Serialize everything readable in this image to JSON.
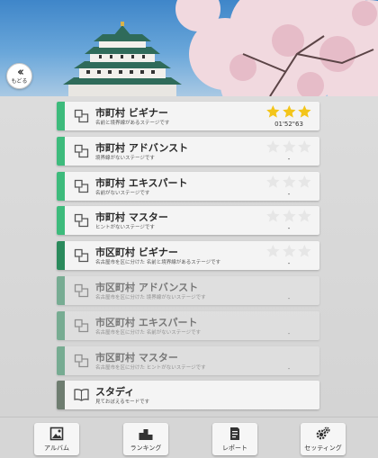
{
  "header": {
    "back_label": "もどる"
  },
  "stages": [
    {
      "title": "市町村 ビギナー",
      "subtitle": "名前と境界線があるステージです",
      "stripe_color": "#3dbb7c",
      "stars_earned": 3,
      "time": "01'52\"63",
      "enabled": true
    },
    {
      "title": "市町村 アドバンスト",
      "subtitle": "境界線がないステージです",
      "stripe_color": "#3dbb7c",
      "stars_earned": 0,
      "time": "-",
      "enabled": true
    },
    {
      "title": "市町村 エキスパート",
      "subtitle": "名前がないステージです",
      "stripe_color": "#3dbb7c",
      "stars_earned": 0,
      "time": "-",
      "enabled": true
    },
    {
      "title": "市町村 マスター",
      "subtitle": "ヒントがないステージです",
      "stripe_color": "#3dbb7c",
      "stars_earned": 0,
      "time": "-",
      "enabled": true
    },
    {
      "title": "市区町村 ビギナー",
      "subtitle": "名古屋市を区に分けた 名前と境界線があるステージです",
      "stripe_color": "#2a8a5c",
      "stars_earned": 0,
      "time": "-",
      "enabled": true
    },
    {
      "title": "市区町村 アドバンスト",
      "subtitle": "名古屋市を区に分けた 境界線がないステージです",
      "stripe_color": "#2a8a5c",
      "stars_earned": 0,
      "time": "-",
      "enabled": false
    },
    {
      "title": "市区町村 エキスパート",
      "subtitle": "名古屋市を区に分けた 名前がないステージです",
      "stripe_color": "#2a8a5c",
      "stars_earned": 0,
      "time": "-",
      "enabled": false
    },
    {
      "title": "市区町村 マスター",
      "subtitle": "名古屋市を区に分けた ヒントがないステージです",
      "stripe_color": "#2a8a5c",
      "stars_earned": 0,
      "time": "-",
      "enabled": false
    }
  ],
  "study": {
    "title": "スタディ",
    "subtitle": "見ておぼえるモードです",
    "stripe_color": "#6e7d70"
  },
  "footer": {
    "album": "アルバム",
    "ranking": "ランキング",
    "report": "レポート",
    "settings": "セッティング"
  },
  "colors": {
    "star_gold": "#f3c51a",
    "star_empty": "#e6e6e6"
  }
}
